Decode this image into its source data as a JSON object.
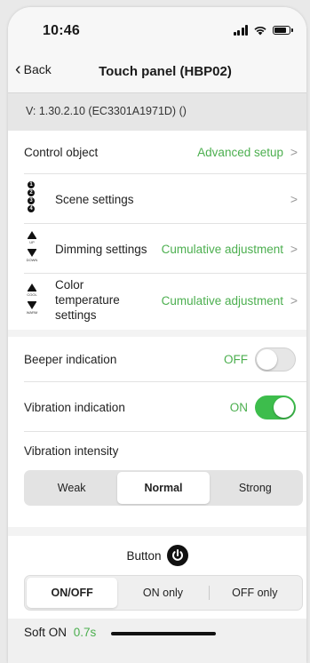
{
  "status": {
    "time": "10:46"
  },
  "nav": {
    "back_label": "Back",
    "title": "Touch panel  (HBP02)"
  },
  "version": "V: 1.30.2.10  (EC3301A1971D) ()",
  "settings": {
    "control_object": {
      "label": "Control object",
      "value": "Advanced setup"
    },
    "scene": {
      "label": "Scene settings",
      "icon_numbers": [
        "1",
        "2",
        "3",
        "4"
      ]
    },
    "dimming": {
      "label": "Dimming settings",
      "value": "Cumulative adjustment",
      "icon_up": "UP",
      "icon_down": "DOWN"
    },
    "color_temp": {
      "label": "Color\ntemperature\nsettings",
      "value": "Cumulative adjustment",
      "icon_up": "COOL",
      "icon_down": "WARM"
    }
  },
  "indications": {
    "beeper": {
      "label": "Beeper indication",
      "state_text": "OFF",
      "on": false
    },
    "vibration": {
      "label": "Vibration indication",
      "state_text": "ON",
      "on": true
    },
    "intensity": {
      "label": "Vibration intensity",
      "options": [
        "Weak",
        "Normal",
        "Strong"
      ],
      "selected": "Normal"
    }
  },
  "button": {
    "label": "Button",
    "options": [
      "ON/OFF",
      "ON only",
      "OFF only"
    ],
    "selected": "ON/OFF",
    "soft_on_label": "Soft ON",
    "soft_on_value": "0.7s"
  },
  "colors": {
    "accent_green": "#4caf4f",
    "toggle_green": "#3dbd4c"
  },
  "icons": [
    "chevron-left-icon",
    "chevron-right-icon",
    "power-icon",
    "signal-icon",
    "wifi-icon",
    "battery-icon"
  ]
}
